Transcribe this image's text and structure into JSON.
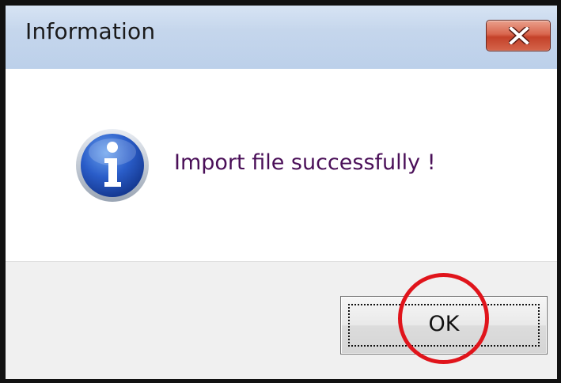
{
  "window": {
    "title": "Information",
    "close_icon": "close-x-icon"
  },
  "content": {
    "icon": "information-icon",
    "message": "Import file successfully !"
  },
  "footer": {
    "ok_label": "OK"
  },
  "annotation": {
    "type": "highlight-circle",
    "color": "#e0141b",
    "target": "ok-button"
  },
  "colors": {
    "titlebar": "#c5d6ec",
    "close_button": "#d4583f",
    "message_text": "#4a0f58",
    "footer_background": "#f0f0f0"
  }
}
